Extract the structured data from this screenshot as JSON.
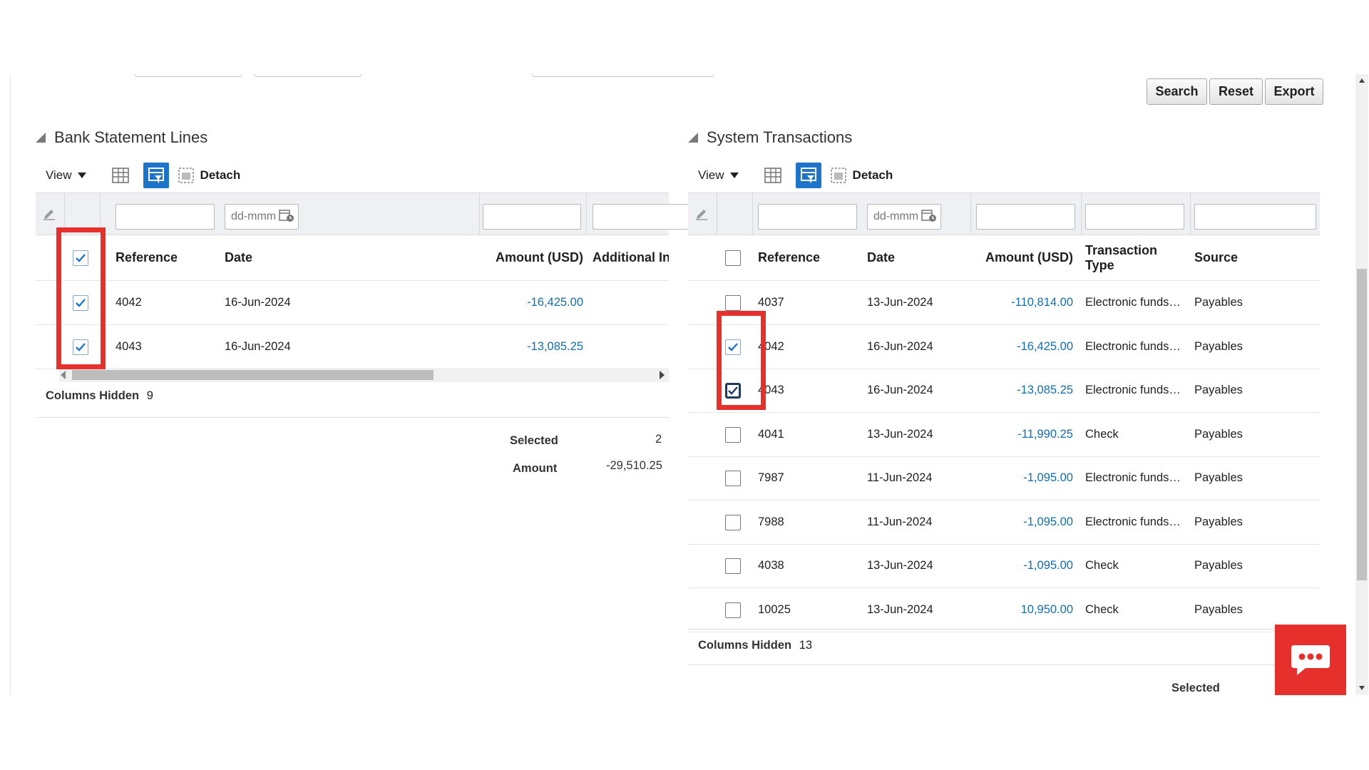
{
  "actions": {
    "search_label": "Search",
    "reset_label": "Reset",
    "export_label": "Export"
  },
  "bank_panel": {
    "title": "Bank Statement Lines",
    "toolbar": {
      "view_label": "View",
      "detach_label": "Detach"
    },
    "filter": {
      "date_placeholder": "dd-mmm"
    },
    "columns": [
      "Reference",
      "Date",
      "Amount (USD)",
      "Additional Info"
    ],
    "header_select_all_checked": true,
    "rows": [
      {
        "reference": "4042",
        "date": "16-Jun-2024",
        "amount": "-16,425.00",
        "checked": true
      },
      {
        "reference": "4043",
        "date": "16-Jun-2024",
        "amount": "-13,085.25",
        "checked": true
      }
    ],
    "columns_hidden_label": "Columns Hidden",
    "columns_hidden_count": "9",
    "summary": {
      "selected_label": "Selected",
      "selected_value": "2",
      "amount_label": "Amount",
      "amount_value": "-29,510.25"
    }
  },
  "system_panel": {
    "title": "System Transactions",
    "toolbar": {
      "view_label": "View",
      "detach_label": "Detach"
    },
    "filter": {
      "date_placeholder": "dd-mmm"
    },
    "columns": [
      "Reference",
      "Date",
      "Amount (USD)",
      "Transaction Type",
      "Source"
    ],
    "header_select_all_checked": false,
    "rows": [
      {
        "reference": "4037",
        "date": "13-Jun-2024",
        "amount": "-110,814.00",
        "type": "Electronic funds…",
        "source": "Payables",
        "checked": false
      },
      {
        "reference": "4042",
        "date": "16-Jun-2024",
        "amount": "-16,425.00",
        "type": "Electronic funds…",
        "source": "Payables",
        "checked": true
      },
      {
        "reference": "4043",
        "date": "16-Jun-2024",
        "amount": "-13,085.25",
        "type": "Electronic funds…",
        "source": "Payables",
        "checked": true
      },
      {
        "reference": "4041",
        "date": "13-Jun-2024",
        "amount": "-11,990.25",
        "type": "Check",
        "source": "Payables",
        "checked": false
      },
      {
        "reference": "7987",
        "date": "11-Jun-2024",
        "amount": "-1,095.00",
        "type": "Electronic funds…",
        "source": "Payables",
        "checked": false
      },
      {
        "reference": "7988",
        "date": "11-Jun-2024",
        "amount": "-1,095.00",
        "type": "Electronic funds…",
        "source": "Payables",
        "checked": false
      },
      {
        "reference": "4038",
        "date": "13-Jun-2024",
        "amount": "-1,095.00",
        "type": "Check",
        "source": "Payables",
        "checked": false
      },
      {
        "reference": "10025",
        "date": "13-Jun-2024",
        "amount": "10,950.00",
        "type": "Check",
        "source": "Payables",
        "checked": false
      }
    ],
    "columns_hidden_label": "Columns Hidden",
    "columns_hidden_count": "13",
    "summary": {
      "selected_label": "Selected"
    }
  },
  "icons": {
    "collapse": "collapse-triangle-icon",
    "freeze": "freeze-columns-icon",
    "query_by_example": "query-by-example-icon",
    "detach": "detach-icon",
    "edit": "pencil-icon",
    "calendar": "calendar-icon",
    "chat": "chat-bubble-icon"
  },
  "colors": {
    "accent_blue": "#1e74c8",
    "amount_blue": "#136ea8",
    "highlight_red": "#e5302c"
  }
}
